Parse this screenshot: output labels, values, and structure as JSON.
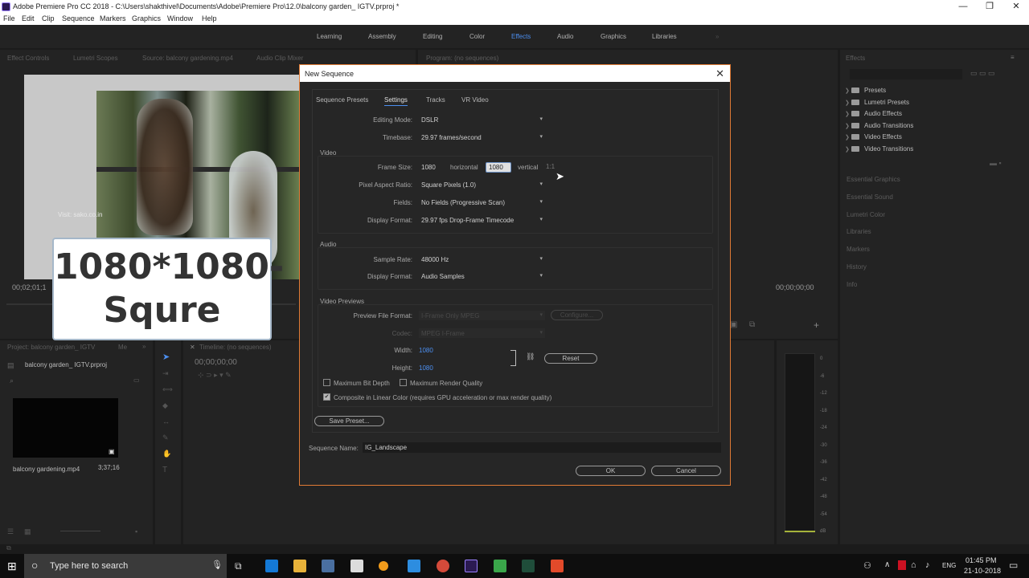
{
  "window": {
    "title": "Adobe Premiere Pro CC 2018 - C:\\Users\\shakthivel\\Documents\\Adobe\\Premiere Pro\\12.0\\balcony garden_ IGTV.prproj *",
    "controls": {
      "minimize": "—",
      "maximize": "❐",
      "close": "✕"
    }
  },
  "menu": [
    "File",
    "Edit",
    "Clip",
    "Sequence",
    "Markers",
    "Graphics",
    "Window",
    "Help"
  ],
  "workspaces": {
    "items": [
      "Learning",
      "Assembly",
      "Editing",
      "Color",
      "Effects",
      "Audio",
      "Graphics",
      "Libraries"
    ],
    "active": "Effects",
    "more": "»"
  },
  "source_panel": {
    "tabs": [
      "Effect Controls",
      "Lumetri Scopes",
      "Source: balcony gardening.mp4",
      "Audio Clip Mixer"
    ],
    "timecode_left": "00;02;01;1",
    "watermark": "Visit: sako.co.in"
  },
  "program_panel": {
    "tab": "Program: (no sequences)",
    "timecode": "00;00;00;00"
  },
  "overlay": {
    "line1": "1080*1080-",
    "line2": "Squre"
  },
  "project_panel": {
    "tab": "Project: balcony garden_ IGTV",
    "tab2": "Me",
    "project_file": "balcony garden_ IGTV.prproj",
    "clip_name": "balcony gardening.mp4",
    "clip_duration": "3;37;16"
  },
  "timeline": {
    "tab": "Timeline: (no sequences)",
    "timecode": "00;00;00;00"
  },
  "dialog": {
    "title": "New Sequence",
    "close": "✕",
    "tabs": [
      "Sequence Presets",
      "Settings",
      "Tracks",
      "VR Video"
    ],
    "active_tab": "Settings",
    "editing_mode": {
      "label": "Editing Mode:",
      "value": "DSLR"
    },
    "timebase": {
      "label": "Timebase:",
      "value": "29.97  frames/second"
    },
    "video_section": "Video",
    "frame_size": {
      "label": "Frame Size:",
      "horizontal_value": "1080",
      "horizontal_label": "horizontal",
      "vertical_value": "1080",
      "vertical_label": "vertical",
      "ratio": "1:1"
    },
    "pixel_aspect": {
      "label": "Pixel Aspect Ratio:",
      "value": "Square Pixels (1.0)"
    },
    "fields": {
      "label": "Fields:",
      "value": "No Fields (Progressive Scan)"
    },
    "video_display_format": {
      "label": "Display Format:",
      "value": "29.97 fps Drop-Frame Timecode"
    },
    "audio_section": "Audio",
    "sample_rate": {
      "label": "Sample Rate:",
      "value": "48000 Hz"
    },
    "audio_display_format": {
      "label": "Display Format:",
      "value": "Audio Samples"
    },
    "previews_section": "Video Previews",
    "preview_format": {
      "label": "Preview File Format:",
      "value": "I-Frame Only MPEG",
      "configure": "Configure..."
    },
    "codec": {
      "label": "Codec:",
      "value": "MPEG I-Frame"
    },
    "width": {
      "label": "Width:",
      "value": "1080"
    },
    "height": {
      "label": "Height:",
      "value": "1080"
    },
    "reset": "Reset",
    "max_bit_depth": "Maximum Bit Depth",
    "max_render_quality": "Maximum Render Quality",
    "linear_color": "Composite in Linear Color (requires GPU acceleration or max render quality)",
    "save_preset": "Save Preset...",
    "sequence_name": {
      "label": "Sequence Name:",
      "value": "IG_Landscape"
    },
    "ok": "OK",
    "cancel": "Cancel"
  },
  "effects_panel": {
    "tab": "Effects",
    "tree": [
      "Presets",
      "Lumetri Presets",
      "Audio Effects",
      "Audio Transitions",
      "Video Effects",
      "Video Transitions"
    ],
    "collapsed_panels": [
      "Essential Graphics",
      "Essential Sound",
      "Lumetri Color",
      "Libraries",
      "Markers",
      "History",
      "Info"
    ]
  },
  "audio_meter": {
    "scale": [
      "0",
      "-6",
      "-12",
      "-18",
      "-24",
      "-30",
      "-36",
      "-42",
      "-48",
      "-54",
      "dB"
    ]
  },
  "taskbar": {
    "search_placeholder": "Type here to search",
    "time": "01:45 PM",
    "date": "21-10-2018",
    "language": "ENG"
  }
}
